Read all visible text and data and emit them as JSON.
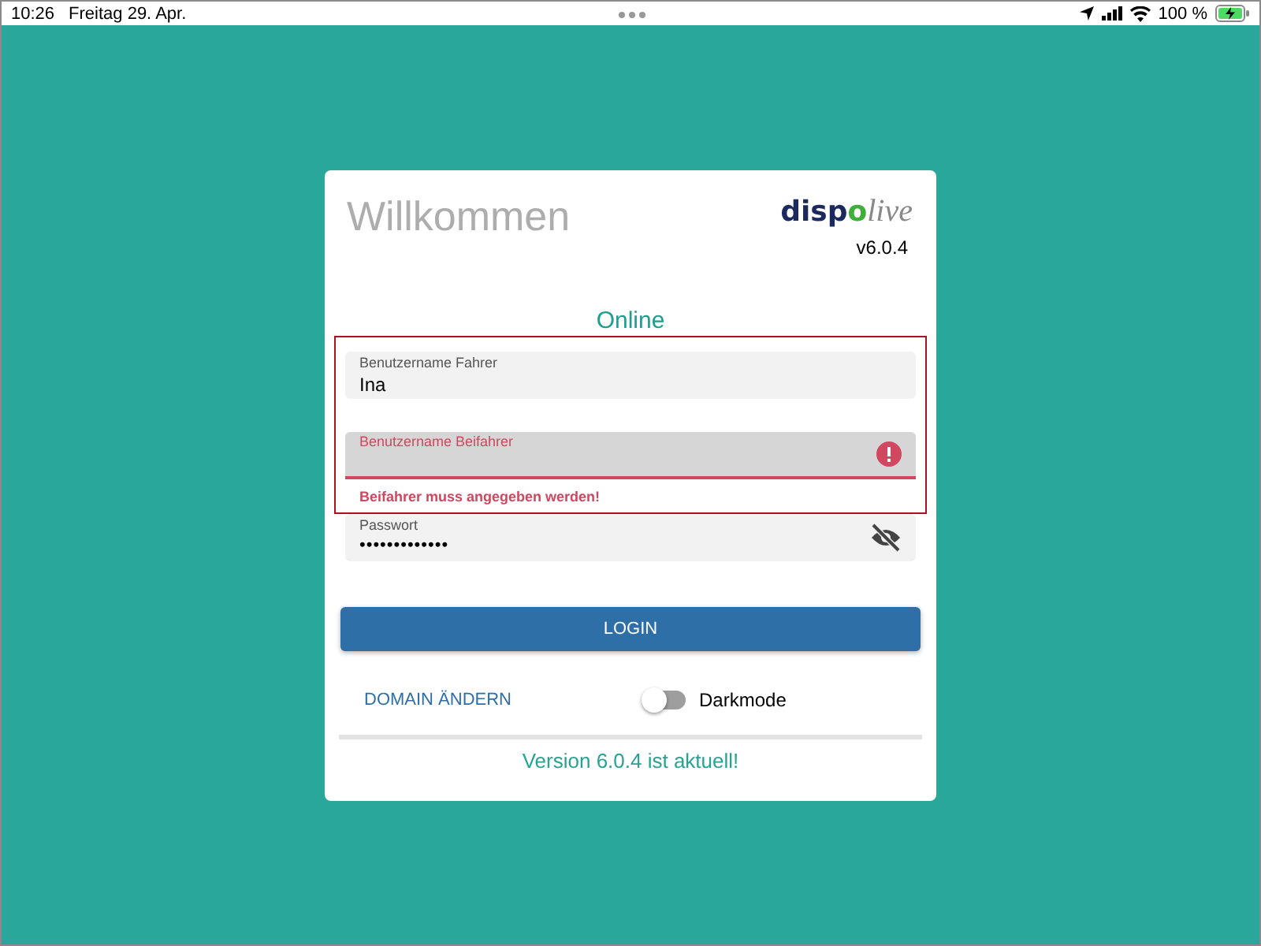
{
  "status_bar": {
    "time": "10:26",
    "date": "Freitag 29. Apr.",
    "battery": "100 %"
  },
  "card": {
    "title": "Willkommen",
    "logo": "dispolive",
    "version": "v6.0.4",
    "connection": "Online",
    "fields": [
      {
        "kind": "text",
        "label": "Benutzername Fahrer",
        "value": "Ina"
      },
      {
        "kind": "text",
        "label": "Benutzername Beifahrer",
        "error": true,
        "error_message": "Beifahrer muss angegeben werden!"
      },
      {
        "kind": "password",
        "label": "Passwort",
        "value": "•••••••••••••",
        "revealed": false
      }
    ],
    "login_button": "LOGIN",
    "domain_link": "DOMAIN ÄNDERN",
    "darkmode": {
      "label": "Darkmode",
      "on": false
    },
    "update_status": "Version 6.0.4 ist aktuell!"
  }
}
